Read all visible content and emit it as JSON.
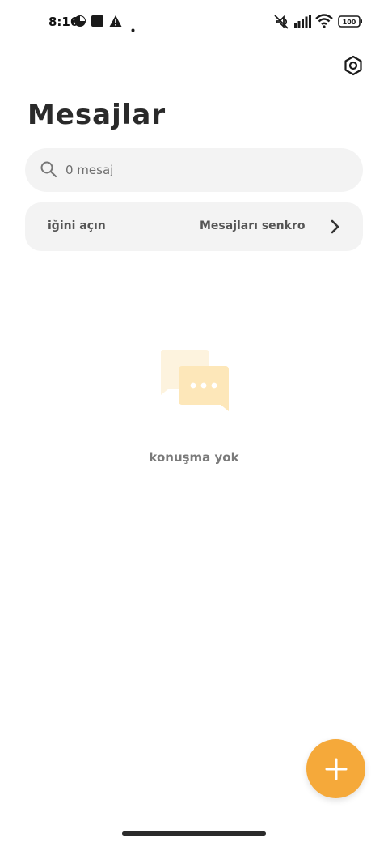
{
  "status_bar": {
    "time": "8:16",
    "battery": "100",
    "icons": [
      "pie-icon",
      "square-icon",
      "warning-icon",
      "dot-icon",
      "mute-icon",
      "signal-icon",
      "wifi-icon",
      "battery-icon"
    ]
  },
  "header": {
    "title": "Mesajlar",
    "settings_icon": "settings-hexagon-icon"
  },
  "search": {
    "placeholder": "0 mesaj",
    "value": ""
  },
  "sync_banner": {
    "left_text": "iğini açın",
    "right_text": "Mesajları senkro",
    "chevron_icon": "chevron-right-icon"
  },
  "empty_state": {
    "icon": "chat-bubbles-icon",
    "text": "konuşma yok"
  },
  "fab": {
    "icon": "plus-icon"
  },
  "colors": {
    "accent": "#f5a93a",
    "surface": "#f3f3f3",
    "illustration_back": "#fdf3de",
    "illustration_front": "#fde7b9"
  }
}
